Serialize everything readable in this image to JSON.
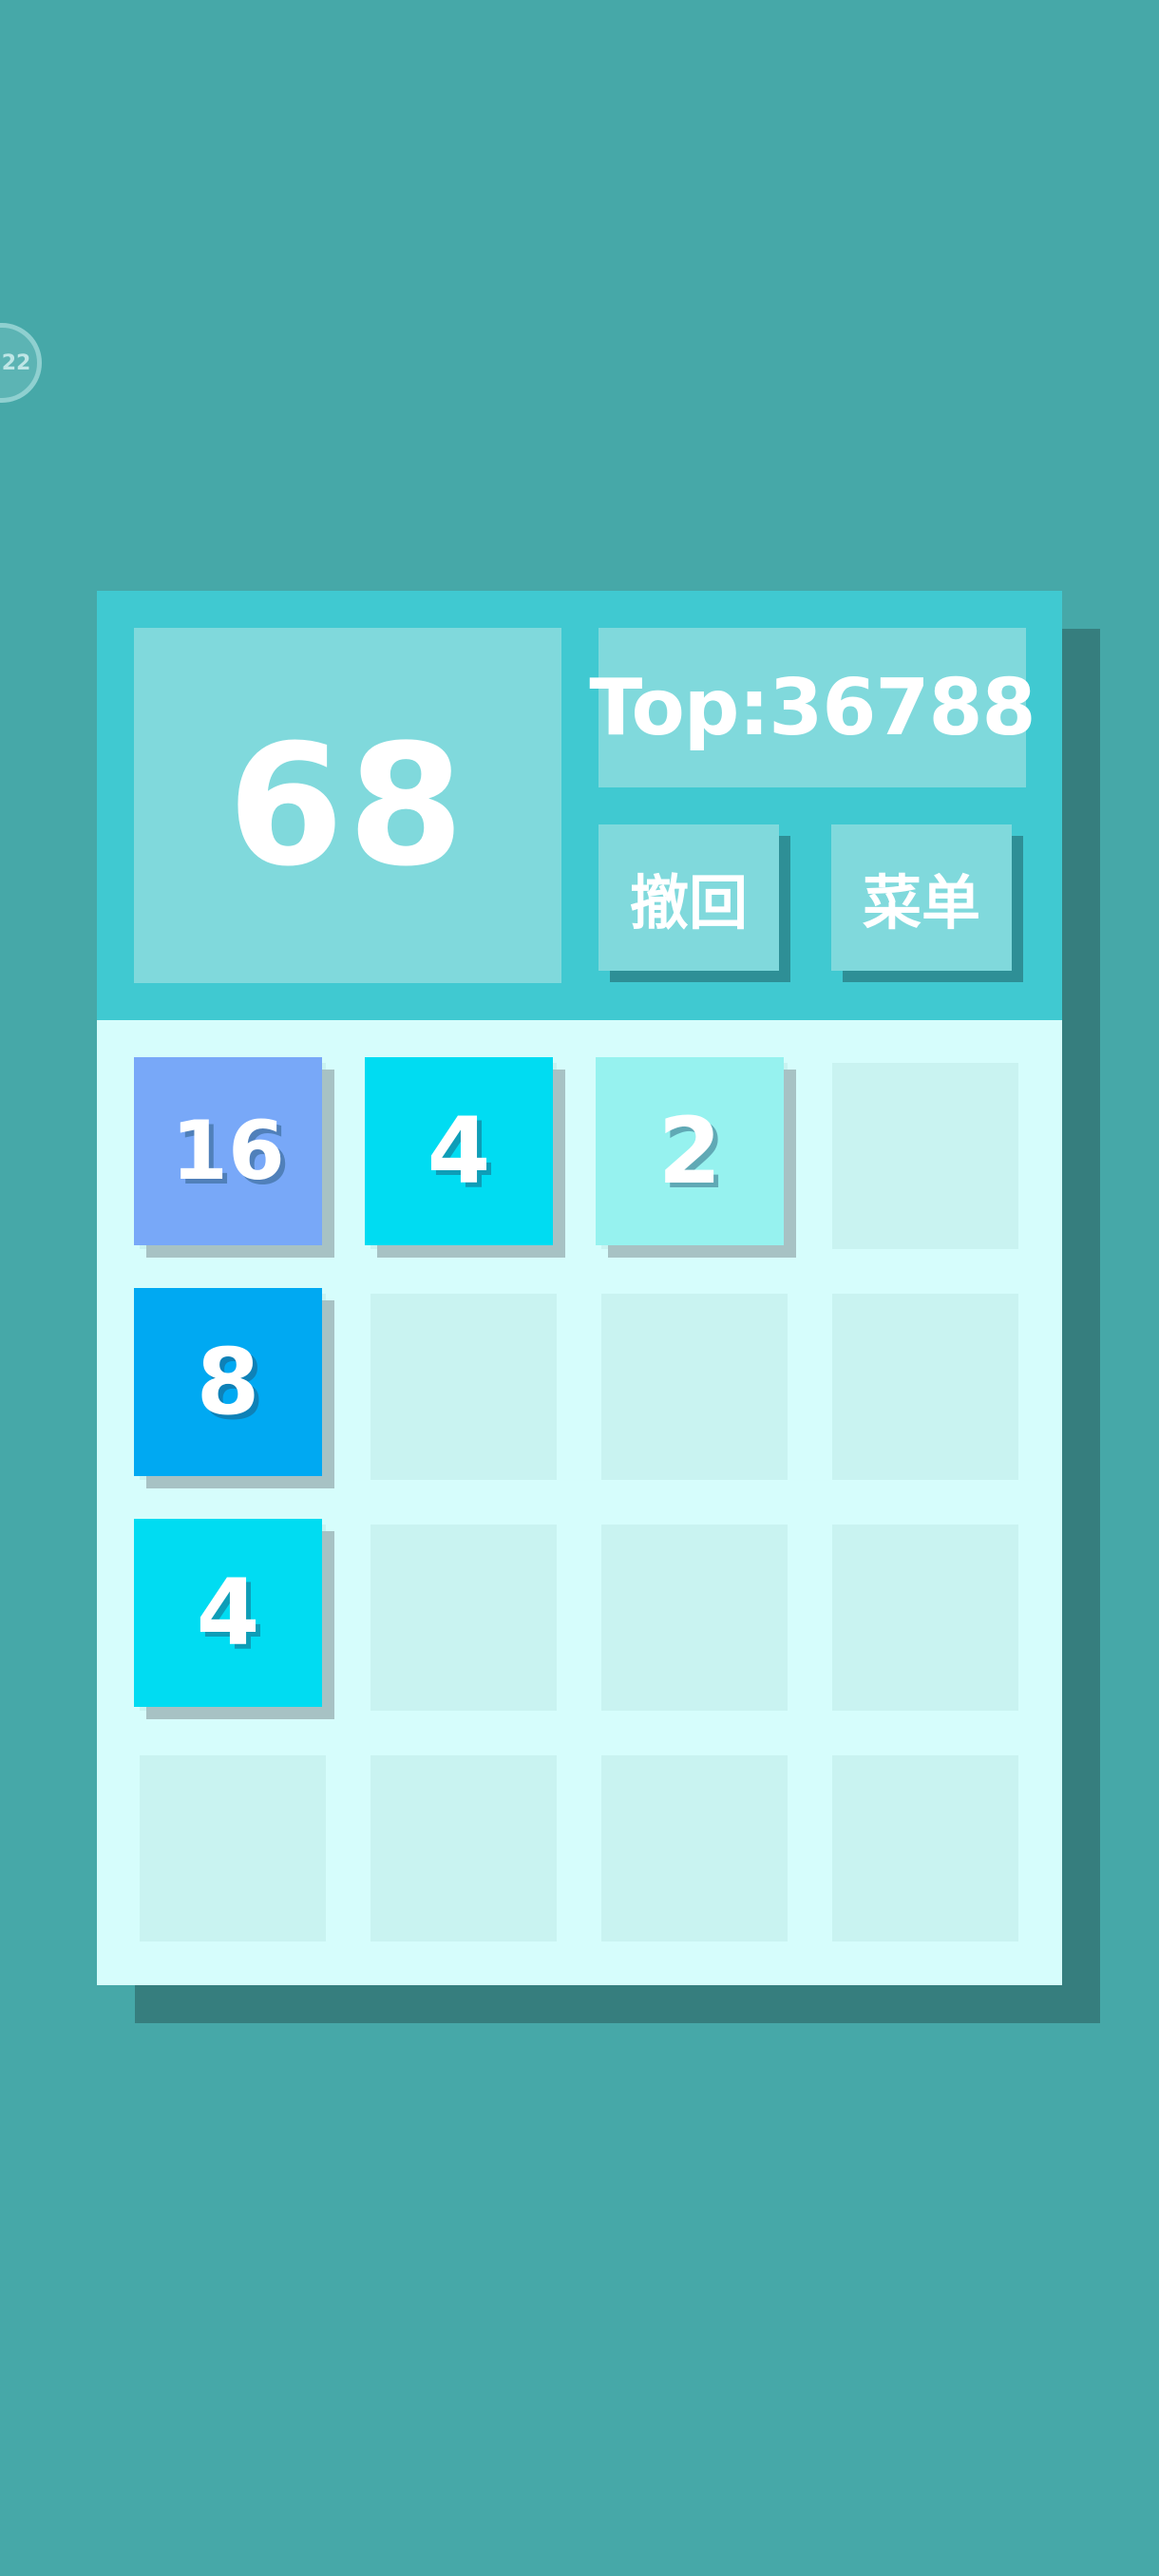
{
  "badge": {
    "text": "22"
  },
  "score": {
    "current": "68",
    "top": "Top:36788"
  },
  "buttons": {
    "undo": "撤回",
    "menu": "菜单"
  },
  "colors": {
    "background": "#46a8a8",
    "header": "#40c9d1",
    "panel": "#80d9dc",
    "grid": "#d6fdfc",
    "empty_cell": "#c9f3f1",
    "tile_2": "#96f2ef",
    "tile_4": "#00dcf2",
    "tile_8": "#00a9f2",
    "tile_16": "#78a8f8"
  },
  "grid": {
    "rows": 4,
    "cols": 4,
    "tiles": [
      {
        "row": 0,
        "col": 0,
        "value": "16"
      },
      {
        "row": 0,
        "col": 1,
        "value": "4"
      },
      {
        "row": 0,
        "col": 2,
        "value": "2"
      },
      {
        "row": 1,
        "col": 0,
        "value": "8"
      },
      {
        "row": 2,
        "col": 0,
        "value": "4"
      }
    ]
  }
}
